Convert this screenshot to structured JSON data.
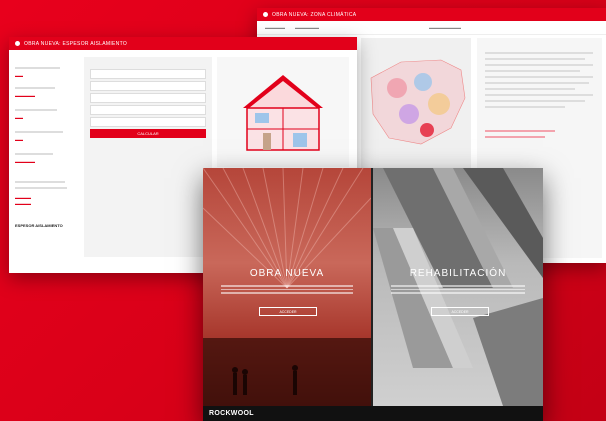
{
  "back_window": {
    "title": "OBRA NUEVA: ZONA CLIMÁTICA"
  },
  "mid_window": {
    "title": "OBRA NUEVA: ESPESOR AISLAMIENTO",
    "calc_button": "CALCULAR",
    "result_label": "ESPESOR AISLAMIENTO"
  },
  "hero": {
    "left_heading": "OBRA NUEVA",
    "left_button": "ACCEDER",
    "right_heading": "REHABILITACIÓN",
    "right_button": "ACCEDER"
  },
  "footer": {
    "brand": "ROCKWOOL"
  },
  "colors": {
    "accent": "#e2001a",
    "dark": "#111111"
  }
}
